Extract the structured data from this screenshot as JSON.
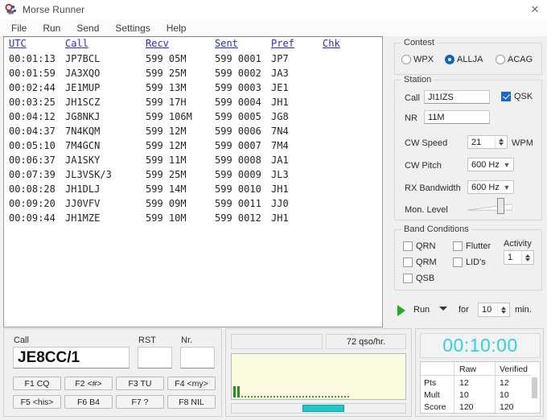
{
  "window": {
    "title": "Morse Runner",
    "icon": "morse-key-icon",
    "close_label": "✕"
  },
  "menu": [
    "File",
    "Run",
    "Send",
    "Settings",
    "Help"
  ],
  "log": {
    "columns": [
      "UTC",
      "Call",
      "Recv",
      "Sent",
      "Pref",
      "Chk"
    ],
    "rows": [
      {
        "utc": "00:01:13",
        "call": "JP7BCL",
        "recv": "599 05M",
        "sent": "599 0001",
        "pref": "JP7",
        "chk": ""
      },
      {
        "utc": "00:01:59",
        "call": "JA3XQO",
        "recv": "599 25M",
        "sent": "599 0002",
        "pref": "JA3",
        "chk": ""
      },
      {
        "utc": "00:02:44",
        "call": "JE1MUP",
        "recv": "599 13M",
        "sent": "599 0003",
        "pref": "JE1",
        "chk": ""
      },
      {
        "utc": "00:03:25",
        "call": "JH1SCZ",
        "recv": "599 17H",
        "sent": "599 0004",
        "pref": "JH1",
        "chk": ""
      },
      {
        "utc": "00:04:12",
        "call": "JG8NKJ",
        "recv": "599 106M",
        "sent": "599 0005",
        "pref": "JG8",
        "chk": ""
      },
      {
        "utc": "00:04:37",
        "call": "7N4KQM",
        "recv": "599 12M",
        "sent": "599 0006",
        "pref": "7N4",
        "chk": ""
      },
      {
        "utc": "00:05:10",
        "call": "7M4GCN",
        "recv": "599 12M",
        "sent": "599 0007",
        "pref": "7M4",
        "chk": ""
      },
      {
        "utc": "00:06:37",
        "call": "JA1SKY",
        "recv": "599 11M",
        "sent": "599 0008",
        "pref": "JA1",
        "chk": ""
      },
      {
        "utc": "00:07:39",
        "call": "JL3VSK/3",
        "recv": "599 25M",
        "sent": "599 0009",
        "pref": "JL3",
        "chk": ""
      },
      {
        "utc": "00:08:28",
        "call": "JH1DLJ",
        "recv": "599 14M",
        "sent": "599 0010",
        "pref": "JH1",
        "chk": ""
      },
      {
        "utc": "00:09:20",
        "call": "JJ0VFV",
        "recv": "599 09M",
        "sent": "599 0011",
        "pref": "JJ0",
        "chk": ""
      },
      {
        "utc": "00:09:44",
        "call": "JH1MZE",
        "recv": "599 10M",
        "sent": "599 0012",
        "pref": "JH1",
        "chk": ""
      }
    ]
  },
  "contest": {
    "group_label": "Contest",
    "options": [
      "WPX",
      "ALLJA",
      "ACAG"
    ],
    "selected": "ALLJA"
  },
  "station": {
    "group_label": "Station",
    "call_label": "Call",
    "call_value": "JI1IZS",
    "nr_label": "NR",
    "nr_value": "11M",
    "qsk_label": "QSK",
    "qsk_checked": true,
    "cw_speed_label": "CW Speed",
    "cw_speed_value": "21",
    "wpm_label": "WPM",
    "cw_pitch_label": "CW Pitch",
    "cw_pitch_value": "600 Hz",
    "rx_bandwidth_label": "RX Bandwidth",
    "rx_bandwidth_value": "600 Hz",
    "mon_level_label": "Mon. Level"
  },
  "band_conditions": {
    "group_label": "Band Conditions",
    "items": [
      {
        "label": "QRN",
        "checked": false
      },
      {
        "label": "QRM",
        "checked": false
      },
      {
        "label": "QSB",
        "checked": false
      },
      {
        "label": "Flutter",
        "checked": false
      },
      {
        "label": "LID's",
        "checked": false
      }
    ],
    "activity_label": "Activity",
    "activity_value": "1"
  },
  "run_bar": {
    "mode_label": "Run",
    "for_label": "for",
    "minutes_value": "10",
    "min_label": "min."
  },
  "entry": {
    "call_label": "Call",
    "call_value": "JE8CC/1",
    "rst_label": "RST",
    "rst_value": "",
    "nr_label": "Nr.",
    "nr_value": "",
    "function_keys": [
      "F1 CQ",
      "F2 <#>",
      "F3 TU",
      "F4 <my>",
      "F5 <his>",
      "F6 B4",
      "F7 ?",
      "F8 NIL"
    ]
  },
  "center": {
    "status_text": "",
    "rate_text": "72 qso/hr."
  },
  "score": {
    "clock": "00:10:00",
    "columns": [
      "",
      "Raw",
      "Verified"
    ],
    "rows": [
      {
        "label": "Pts",
        "raw": "12",
        "verified": "12"
      },
      {
        "label": "Mult",
        "raw": "10",
        "verified": "10"
      },
      {
        "label": "Score",
        "raw": "120",
        "verified": "120"
      }
    ]
  },
  "colors": {
    "accent_blue": "#1669c8",
    "link_blue": "#2a2ae0",
    "clock_cyan": "#2ad6d6",
    "wave_bg": "#fbfbe0",
    "wave_green": "#199919",
    "play_green": "#19b019"
  }
}
